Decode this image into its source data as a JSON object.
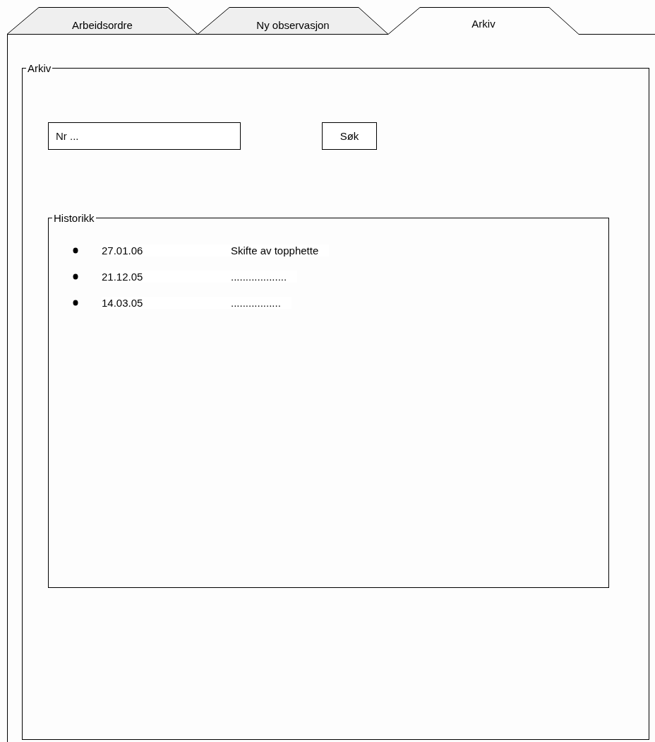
{
  "tabs": [
    {
      "label": "Arbeidsordre",
      "selected": false
    },
    {
      "label": "Ny observasjon",
      "selected": false
    },
    {
      "label": "Arkiv",
      "selected": true
    }
  ],
  "archive": {
    "title": "Arkiv",
    "search": {
      "placeholder": "Nr ..."
    },
    "search_button": "Søk",
    "history": {
      "title": "Historikk",
      "entries": [
        {
          "date": "27.01.06",
          "description": "Skifte av topphette"
        },
        {
          "date": "21.12.05",
          "description": "..................."
        },
        {
          "date": "14.03.05",
          "description": "................."
        }
      ]
    }
  }
}
